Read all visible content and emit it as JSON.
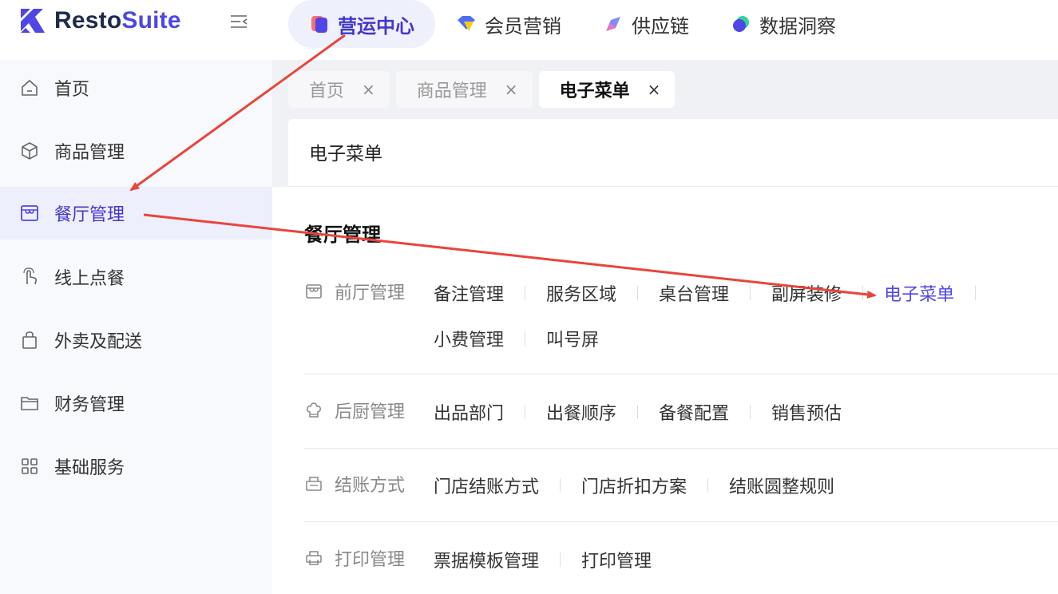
{
  "brand": {
    "name_part1": "Resto",
    "name_part2": "Suite",
    "accent_color": "#4f46e5"
  },
  "topnav": [
    {
      "label": "营运中心",
      "icon": "operations-icon",
      "active": true
    },
    {
      "label": "会员营销",
      "icon": "member-marketing-icon",
      "active": false
    },
    {
      "label": "供应链",
      "icon": "supply-chain-icon",
      "active": false
    },
    {
      "label": "数据洞察",
      "icon": "data-insight-icon",
      "active": false
    }
  ],
  "sidebar": {
    "items": [
      {
        "label": "首页",
        "icon": "home-icon"
      },
      {
        "label": "商品管理",
        "icon": "box-icon"
      },
      {
        "label": "餐厅管理",
        "icon": "store-icon",
        "active": true
      },
      {
        "label": "线上点餐",
        "icon": "tap-hand-icon"
      },
      {
        "label": "外卖及配送",
        "icon": "bag-icon"
      },
      {
        "label": "财务管理",
        "icon": "folder-icon"
      },
      {
        "label": "基础服务",
        "icon": "grid-icon"
      }
    ]
  },
  "tabs": [
    {
      "label": "首页",
      "close": "×",
      "active": false
    },
    {
      "label": "商品管理",
      "close": "×",
      "active": false
    },
    {
      "label": "电子菜单",
      "close": "×",
      "active": true
    }
  ],
  "page": {
    "title": "电子菜单"
  },
  "panel": {
    "title": "餐厅管理",
    "groups": [
      {
        "name": "前厅管理",
        "icon": "store-icon",
        "rows": [
          [
            "备注管理",
            "服务区域",
            "桌台管理",
            "副屏装修",
            "电子菜单"
          ],
          [
            "小费管理",
            "叫号屏"
          ]
        ],
        "active_link": "电子菜单"
      },
      {
        "name": "后厨管理",
        "icon": "chef-hat-icon",
        "rows": [
          [
            "出品部门",
            "出餐顺序",
            "备餐配置",
            "销售预估"
          ]
        ]
      },
      {
        "name": "结账方式",
        "icon": "checkout-icon",
        "rows": [
          [
            "门店结账方式",
            "门店折扣方案",
            "结账圆整规则"
          ]
        ]
      },
      {
        "name": "打印管理",
        "icon": "printer-icon",
        "rows": [
          [
            "票据模板管理",
            "打印管理"
          ]
        ]
      }
    ]
  },
  "annotation_color": "#e8453c"
}
